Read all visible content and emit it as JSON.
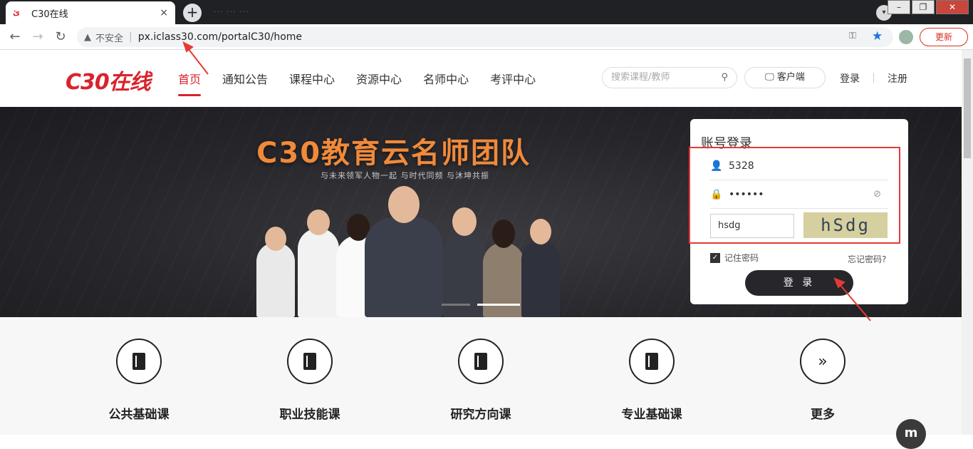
{
  "browser": {
    "tab_title": "C30在线",
    "tab_close": "×",
    "new_tab": "+",
    "inactive_tabs": "···  ···  ···",
    "insecure_label": "不安全",
    "url": "px.iclass30.com/portalC30/home",
    "update_label": "更新",
    "back": "←",
    "forward": "→",
    "reload": "↻"
  },
  "header": {
    "logo": "C30在线",
    "nav": [
      "首页",
      "通知公告",
      "课程中心",
      "资源中心",
      "名师中心",
      "考评中心"
    ],
    "search_placeholder": "搜索课程/教师",
    "client_label": "客户端",
    "login_link": "登录",
    "register_link": "注册"
  },
  "banner": {
    "title": "C30教育云名师团队",
    "subtitle": "与未来领军人物一起 与时代同频 与沐坤共振"
  },
  "login": {
    "heading": "账号登录",
    "username": "5328",
    "password_mask": "••••••",
    "captcha_value": "hsdg",
    "captcha_image_text": "hSdg",
    "remember_label": "记住密码",
    "forgot_label": "忘记密码?",
    "submit_label": "登 录"
  },
  "categories": [
    "公共基础课",
    "职业技能课",
    "研究方向课",
    "专业基础课",
    "更多"
  ],
  "colors": {
    "brand_red": "#d9232c",
    "annotation_red": "#e53935",
    "dark_button": "#26262b",
    "banner_title": "#f08a3a"
  },
  "icons": {
    "search": "search-icon",
    "monitor": "monitor-icon",
    "user": "user-icon",
    "lock": "lock-icon",
    "eye": "eye-slash-icon",
    "book": "book-icon",
    "more": "double-chevron-right-icon"
  }
}
